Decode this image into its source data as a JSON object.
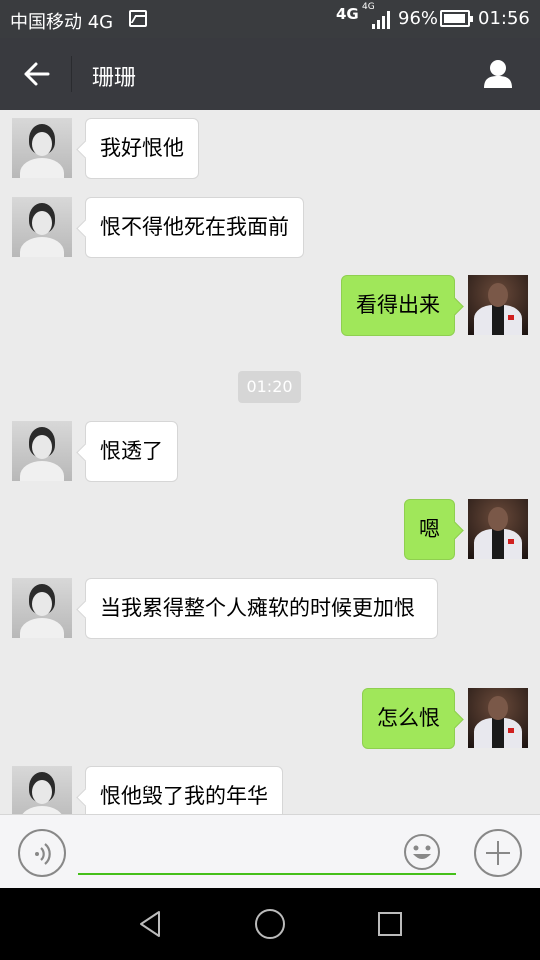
{
  "status_bar": {
    "carrier": "中国移动 4G",
    "network_1": "4G",
    "network_2": "4G",
    "battery_percent": "96%",
    "battery_level": 0.96,
    "time": "01:56"
  },
  "header": {
    "title": "珊珊",
    "back_icon": "arrow-left-icon",
    "profile_icon": "person-icon"
  },
  "messages": [
    {
      "side": "left",
      "text": "我好恨他"
    },
    {
      "side": "left",
      "text": "恨不得他死在我面前"
    },
    {
      "side": "right",
      "text": "看得出来"
    },
    {
      "side": "left",
      "text": "恨透了"
    },
    {
      "side": "right",
      "text": "嗯"
    },
    {
      "side": "left",
      "text": "当我累得整个人瘫软的时候更加恨"
    },
    {
      "side": "right",
      "text": "怎么恨"
    },
    {
      "side": "left",
      "text": "恨他毁了我的年华"
    }
  ],
  "timestamp": "01:20",
  "input_bar": {
    "value": "",
    "voice_icon": "voice-icon",
    "emoji_icon": "emoji-icon",
    "plus_icon": "plus-icon"
  },
  "nav_bar": {
    "back_icon": "triangle-back-icon",
    "home_icon": "circle-home-icon",
    "recent_icon": "square-recent-icon"
  }
}
